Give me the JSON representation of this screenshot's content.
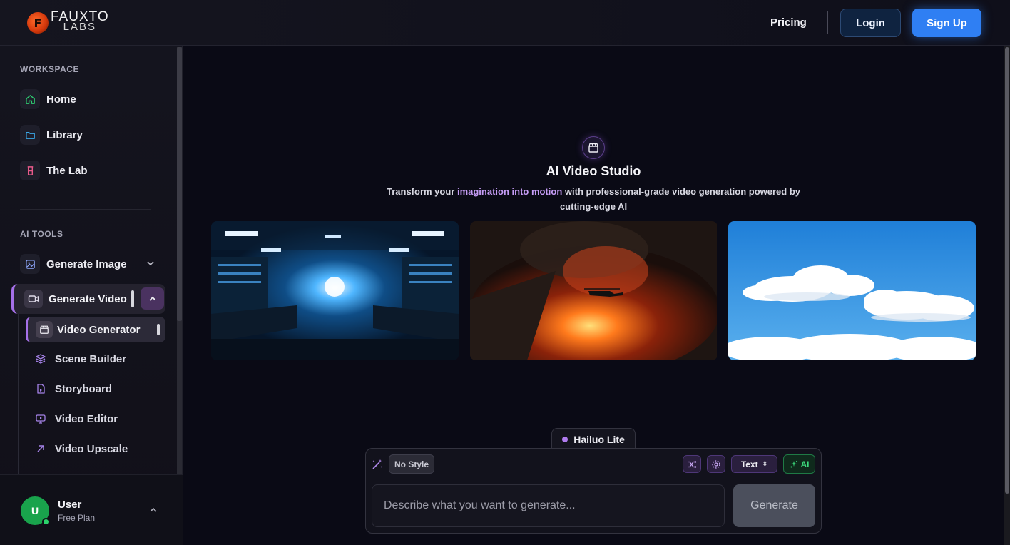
{
  "brand": {
    "line1": "FAUXTO",
    "line2": "LABS",
    "mark": "F"
  },
  "header": {
    "pricing": "Pricing",
    "login": "Login",
    "signup": "Sign Up"
  },
  "sidebar": {
    "workspace_label": "WORKSPACE",
    "workspace_items": [
      {
        "label": "Home",
        "icon": "home-icon",
        "color": "#2ecc71"
      },
      {
        "label": "Library",
        "icon": "folder-icon",
        "color": "#3aa8e8"
      },
      {
        "label": "The Lab",
        "icon": "flask-icon",
        "color": "#e85a8a"
      }
    ],
    "tools_label": "AI TOOLS",
    "generate_image": "Generate Image",
    "generate_video": "Generate Video",
    "video_generator": "Video Generator",
    "sub_items": [
      {
        "label": "Scene Builder",
        "icon": "layers-icon"
      },
      {
        "label": "Storyboard",
        "icon": "document-icon"
      },
      {
        "label": "Video Editor",
        "icon": "monitor-icon"
      },
      {
        "label": "Video Upscale",
        "icon": "arrow-up-right-icon"
      }
    ],
    "user": {
      "initial": "U",
      "name": "User",
      "plan": "Free Plan"
    }
  },
  "studio": {
    "title": "AI Video Studio",
    "subtitle_pre": "Transform your ",
    "subtitle_highlight": "imagination into motion",
    "subtitle_post": " with professional-grade video generation powered by cutting-edge AI"
  },
  "prompt": {
    "model": "Hailuo Lite",
    "style": "No Style",
    "mode": "Text",
    "ai_label": "AI",
    "placeholder": "Describe what you want to generate...",
    "generate": "Generate"
  },
  "colors": {
    "accent": "#a570e8",
    "signup": "#2f7ff3",
    "ai_green": "#3ddc7e"
  }
}
